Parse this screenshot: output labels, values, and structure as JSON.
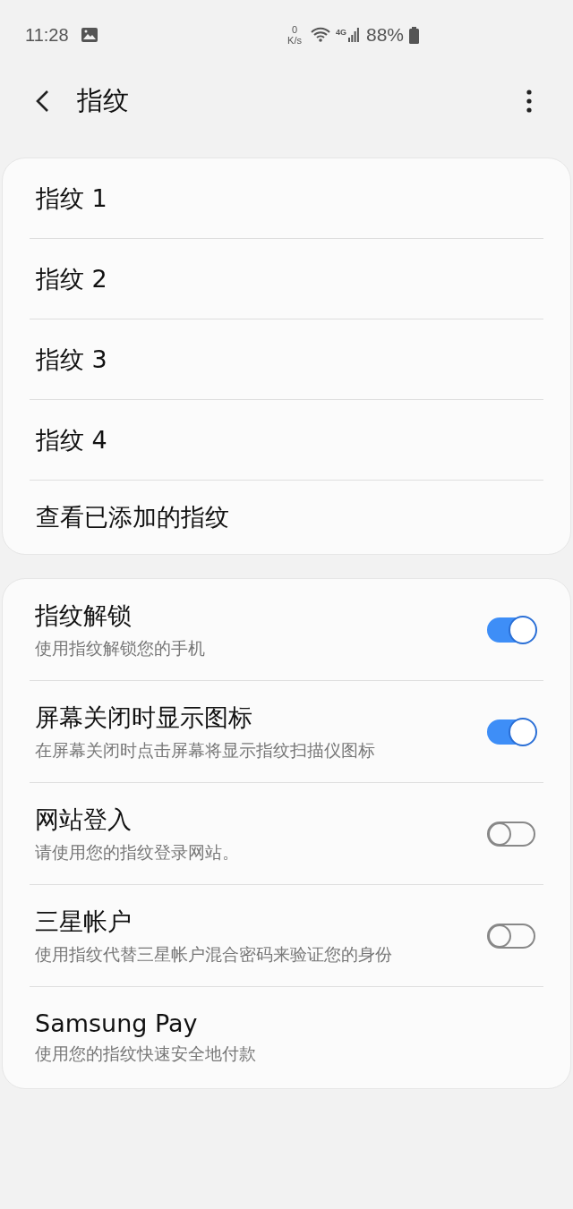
{
  "status_bar": {
    "time": "11:28",
    "speed_value": "0",
    "speed_unit": "K/s",
    "network": "4G",
    "battery": "88%"
  },
  "header": {
    "title": "指纹"
  },
  "fingerprints": [
    {
      "label": "指纹 1"
    },
    {
      "label": "指纹 2"
    },
    {
      "label": "指纹 3"
    },
    {
      "label": "指纹 4"
    },
    {
      "label": "查看已添加的指纹"
    }
  ],
  "settings": [
    {
      "kind": "toggle",
      "title": "指纹解锁",
      "subtitle": "使用指纹解锁您的手机",
      "on": true
    },
    {
      "kind": "toggle",
      "title": "屏幕关闭时显示图标",
      "subtitle": "在屏幕关闭时点击屏幕将显示指纹扫描仪图标",
      "on": true
    },
    {
      "kind": "toggle",
      "title": "网站登入",
      "subtitle": "请使用您的指纹登录网站。",
      "on": false
    },
    {
      "kind": "toggle",
      "title": "三星帐户",
      "subtitle": "使用指纹代替三星帐户混合密码来验证您的身份",
      "on": false
    },
    {
      "kind": "link",
      "title": "Samsung Pay",
      "subtitle": "使用您的指纹快速安全地付款"
    }
  ]
}
